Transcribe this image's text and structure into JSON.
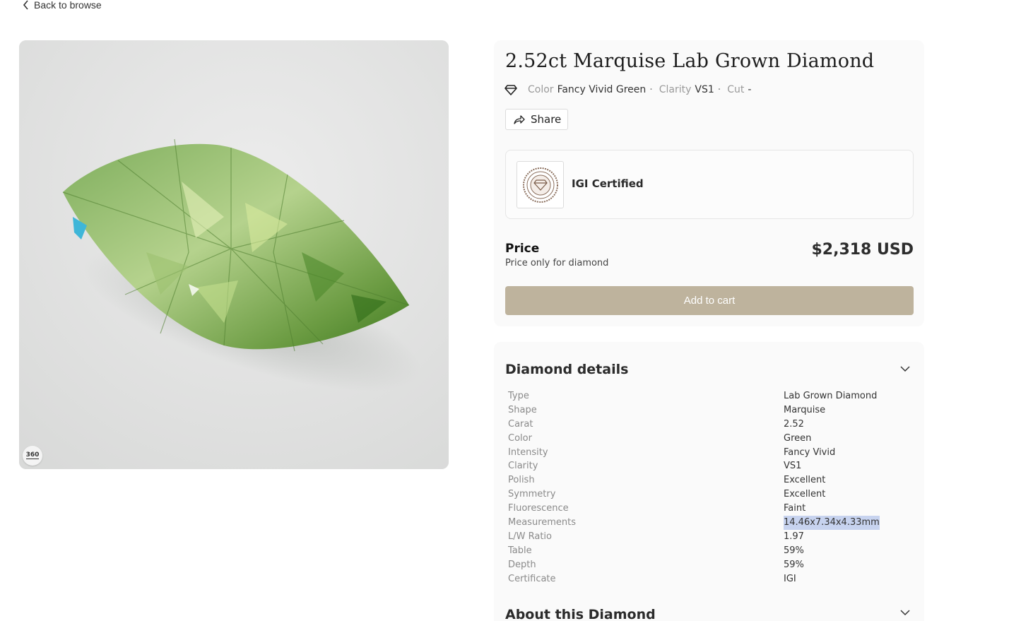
{
  "nav": {
    "back_label": "Back to browse"
  },
  "media": {
    "badge_label": "360"
  },
  "product": {
    "title": "2.52ct Marquise Lab Grown Diamond",
    "specs": [
      {
        "label": "Color",
        "value": "Fancy Vivid Green"
      },
      {
        "label": "Clarity",
        "value": "VS1"
      },
      {
        "label": "Cut",
        "value": "-"
      }
    ],
    "share_label": "Share",
    "certificate": {
      "label": "IGI Certified"
    },
    "price": {
      "label": "Price",
      "note": "Price only for diamond",
      "value": "$2,318 USD"
    },
    "add_to_cart_label": "Add to cart"
  },
  "details": {
    "heading": "Diamond details",
    "rows": [
      {
        "key": "Type",
        "value": "Lab Grown Diamond"
      },
      {
        "key": "Shape",
        "value": "Marquise"
      },
      {
        "key": "Carat",
        "value": "2.52"
      },
      {
        "key": "Color",
        "value": "Green"
      },
      {
        "key": "Intensity",
        "value": "Fancy Vivid"
      },
      {
        "key": "Clarity",
        "value": "VS1"
      },
      {
        "key": "Polish",
        "value": "Excellent"
      },
      {
        "key": "Symmetry",
        "value": "Excellent"
      },
      {
        "key": "Fluorescence",
        "value": "Faint"
      },
      {
        "key": "Measurements",
        "value": "14.46x7.34x4.33mm",
        "selected": true
      },
      {
        "key": "L/W Ratio",
        "value": "1.97"
      },
      {
        "key": "Table",
        "value": "59%"
      },
      {
        "key": "Depth",
        "value": "59%"
      },
      {
        "key": "Certificate",
        "value": "IGI"
      }
    ],
    "about_heading": "About this Diamond"
  },
  "colors": {
    "accent_button": "#beb39d",
    "selection_highlight": "#c7d3ef",
    "stone": "#8bb86a"
  }
}
